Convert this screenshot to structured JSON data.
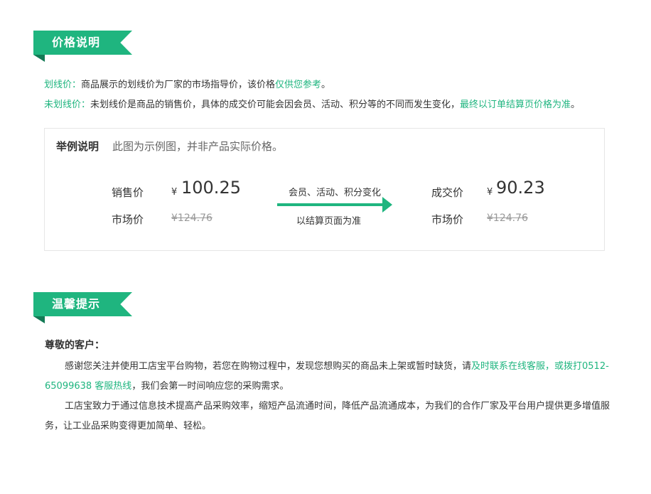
{
  "price_section": {
    "title": "价格说明",
    "line1": {
      "label": "划线价：",
      "text": "商品展示的划线价为厂家的市场指导价，该价格",
      "highlight": "仅供您参考",
      "end": "。"
    },
    "line2": {
      "label": "未划线价：",
      "text": "未划线价是商品的销售价，具体的成交价可能会因会员、活动、积分等的不同而发生变化，",
      "highlight": "最终以订单结算页价格为准",
      "end": "。"
    }
  },
  "example": {
    "title": "举例说明",
    "desc": "此图为示例图，并非产品实际价格。",
    "left": {
      "sale_label": "销售价",
      "yen": "¥",
      "sale_price": "100.25",
      "market_label": "市场价",
      "market_price": "¥124.76"
    },
    "arrow": {
      "top_text": "会员、活动、积分变化",
      "bottom_text": "以结算页面为准"
    },
    "right": {
      "deal_label": "成交价",
      "yen": "¥",
      "deal_price": "90.23",
      "market_label": "市场价",
      "market_price": "¥124.76"
    }
  },
  "tips_section": {
    "title": "温馨提示",
    "greeting": "尊敬的客户：",
    "para1": {
      "text": "感谢您关注并使用工店宝平台购物，若您在购物过程中，发现您想购买的商品未上架或暂时缺货，请",
      "highlight": "及时联系在线客服，或拨打0512-65099638 客服热线",
      "end": "，我们会第一时间响应您的采购需求。"
    },
    "para2": "工店宝致力于通过信息技术提高产品采购效率，缩短产品流通时间，降低产品流通成本，为我们的合作厂家及平台用户提供更多增值服务，让工业品采购变得更加简单、轻松。"
  },
  "colors": {
    "accent": "#1fb57f",
    "accent_dark": "#137a55",
    "text": "#333333",
    "muted": "#999999"
  }
}
